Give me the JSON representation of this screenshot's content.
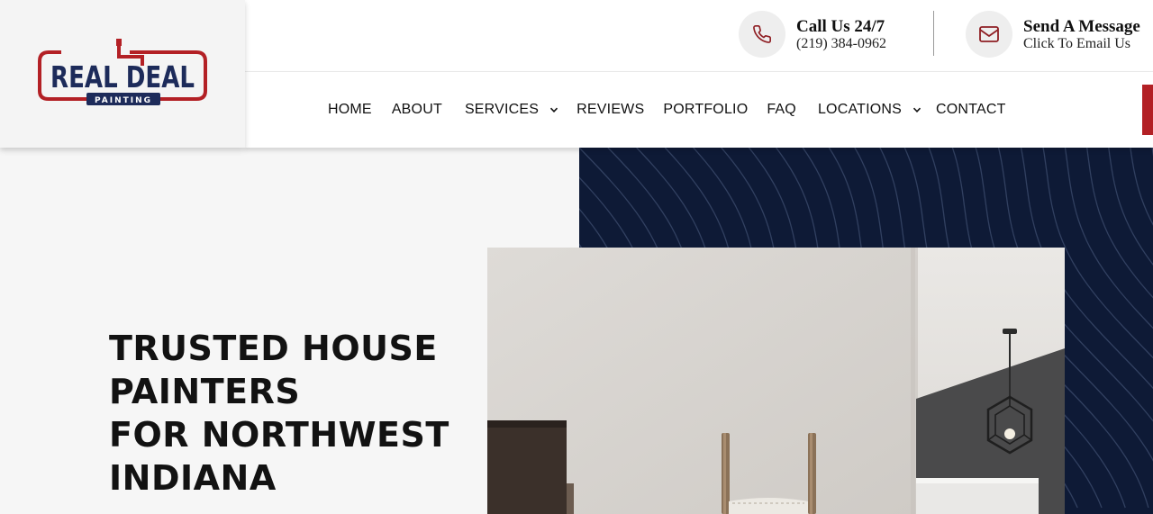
{
  "logo": {
    "top_text": "REAL DEAL",
    "bottom_text": "PAINTING"
  },
  "contact": {
    "call_title": "Call Us 24/7",
    "call_sub": "(219) 384-0962",
    "mail_title": "Send A Message",
    "mail_sub": "Click To Email Us"
  },
  "nav": [
    {
      "label": "HOME"
    },
    {
      "label": "ABOUT"
    },
    {
      "label": "SERVICES"
    },
    {
      "label": "REVIEWS"
    },
    {
      "label": "PORTFOLIO"
    },
    {
      "label": "FAQ"
    },
    {
      "label": "LOCATIONS"
    },
    {
      "label": "CONTACT"
    }
  ],
  "hero": {
    "title_lines": [
      "TRUSTED HOUSE",
      "PAINTERS",
      "FOR NORTHWEST",
      "INDIANA"
    ]
  },
  "colors": {
    "brand_red": "#b32025",
    "brand_navy": "#1d2b5a",
    "navy_panel": "#0e1a36"
  },
  "icons": [
    "phone-icon",
    "mail-icon",
    "chevron-down-icon"
  ]
}
